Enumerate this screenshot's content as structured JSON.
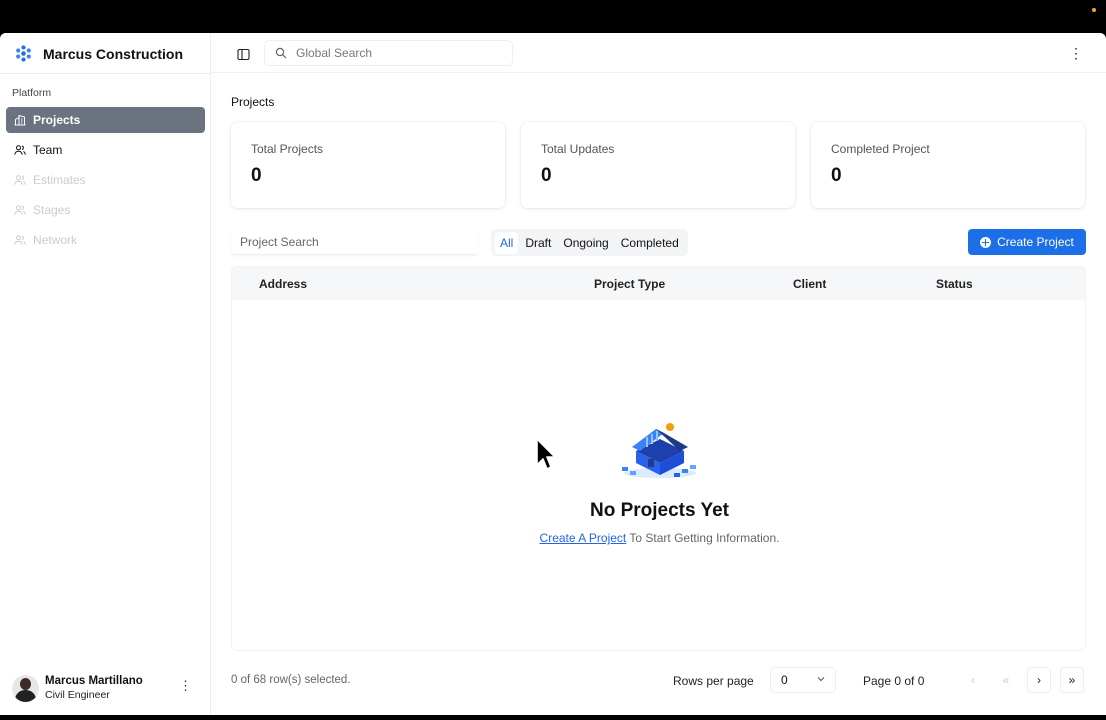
{
  "brand": {
    "name": "Marcus Construction"
  },
  "sidebar": {
    "section_label": "Platform",
    "items": [
      {
        "label": "Projects",
        "icon": "building-icon",
        "state": "active"
      },
      {
        "label": "Team",
        "icon": "users-icon",
        "state": "normal"
      },
      {
        "label": "Estimates",
        "icon": "users-icon",
        "state": "disabled"
      },
      {
        "label": "Stages",
        "icon": "users-icon",
        "state": "disabled"
      },
      {
        "label": "Network",
        "icon": "users-icon",
        "state": "disabled"
      }
    ]
  },
  "user": {
    "name": "Marcus Martillano",
    "role": "Civil Engineer"
  },
  "header": {
    "search_placeholder": "Global Search"
  },
  "page": {
    "title": "Projects"
  },
  "stats": [
    {
      "label": "Total Projects",
      "value": "0"
    },
    {
      "label": "Total Updates",
      "value": "0"
    },
    {
      "label": "Completed Project",
      "value": "0"
    }
  ],
  "filters": {
    "search_placeholder": "Project Search",
    "tabs": [
      "All",
      "Draft",
      "Ongoing",
      "Completed"
    ],
    "active_tab": "All",
    "create_label": "Create Project"
  },
  "table": {
    "columns": [
      "Address",
      "Project Type",
      "Client",
      "Status"
    ],
    "empty_title": "No Projects Yet",
    "empty_link": "Create A Project",
    "empty_text": " To Start Getting Information."
  },
  "footer": {
    "selection": "0 of 68 row(s) selected.",
    "rows_per_page_label": "Rows per page",
    "rows_per_page_value": "0",
    "page_info": "Page 0 of 0"
  },
  "colors": {
    "accent": "#1d6fe8",
    "active_nav": "#6b7280",
    "link": "#2563eb"
  }
}
